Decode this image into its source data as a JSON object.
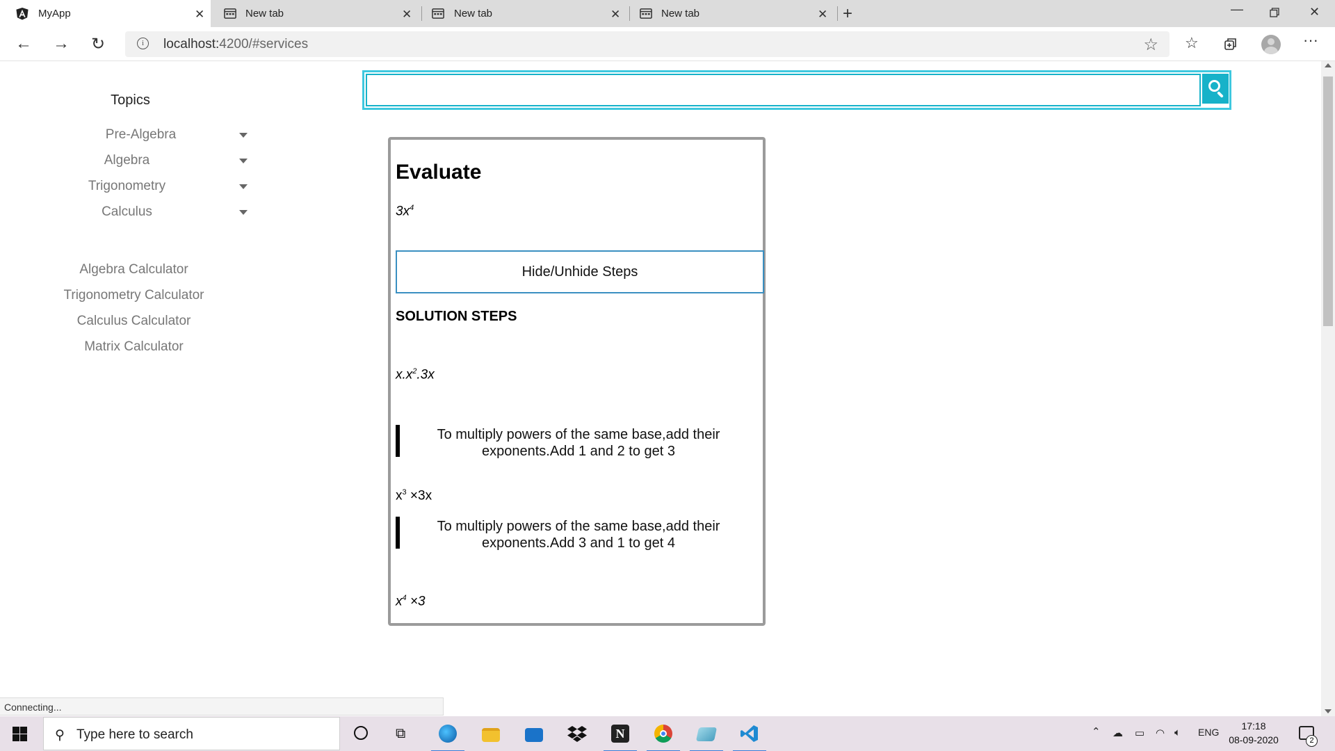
{
  "browser": {
    "tabs": [
      {
        "title": "MyApp",
        "icon": "angular-icon",
        "active": true
      },
      {
        "title": "New tab",
        "icon": "page-icon",
        "active": false
      },
      {
        "title": "New tab",
        "icon": "page-icon",
        "active": false
      },
      {
        "title": "New tab",
        "icon": "page-icon",
        "active": false
      }
    ],
    "url_host": "localhost:",
    "url_path": "4200/#services"
  },
  "sidebar": {
    "title": "Topics",
    "topics": [
      {
        "label": "Pre-Algebra"
      },
      {
        "label": "Algebra"
      },
      {
        "label": "Trigonometry"
      },
      {
        "label": "Calculus"
      }
    ],
    "calculators": [
      {
        "label": "Algebra Calculator"
      },
      {
        "label": "Trigonometry Calculator"
      },
      {
        "label": "Calculus Calculator"
      },
      {
        "label": "Matrix Calculator"
      }
    ]
  },
  "search": {
    "value": "",
    "placeholder": ""
  },
  "solution": {
    "heading": "Evaluate",
    "problem": {
      "base": "3x",
      "exp": "4"
    },
    "toggle_label": "Hide/Unhide Steps",
    "steps_heading": "SOLUTION STEPS",
    "step1": {
      "a": "x.x",
      "exp": "2",
      "b": ".3x"
    },
    "explain1": "To multiply powers of the same base,add their exponents.Add 1 and 2 to get 3",
    "step2": {
      "a": "x",
      "exp": "3",
      "b": " ×3x"
    },
    "explain2": "To multiply powers of the same base,add their exponents.Add 3 and 1 to get 4",
    "step3": {
      "a": "x",
      "exp": "4",
      "b": " ×3"
    }
  },
  "status_text": "Connecting...",
  "taskbar": {
    "search_placeholder": "Type here to search",
    "language": "ENG",
    "time": "17:18",
    "date": "08-09-2020",
    "notification_count": "2",
    "accent_color": "#3b7dd8"
  },
  "colors": {
    "search_border": "#17b2c9",
    "toggle_border": "#3a8fc1",
    "card_border": "#9b9b9b"
  }
}
